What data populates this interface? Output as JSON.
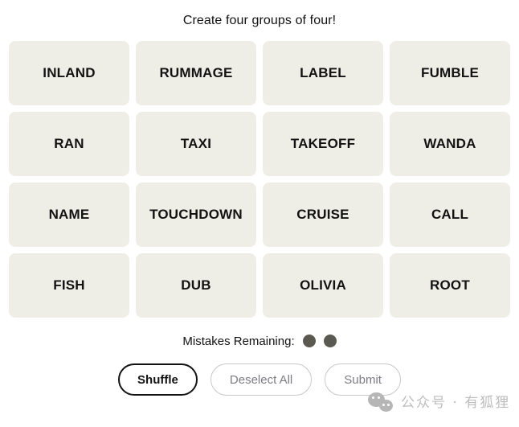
{
  "page": {
    "title": "Create four groups of four!"
  },
  "grid": {
    "tiles": [
      {
        "label": "INLAND"
      },
      {
        "label": "RUMMAGE"
      },
      {
        "label": "LABEL"
      },
      {
        "label": "FUMBLE"
      },
      {
        "label": "RAN"
      },
      {
        "label": "TAXI"
      },
      {
        "label": "TAKEOFF"
      },
      {
        "label": "WANDA"
      },
      {
        "label": "NAME"
      },
      {
        "label": "TOUCHDOWN"
      },
      {
        "label": "CRUISE"
      },
      {
        "label": "CALL"
      },
      {
        "label": "FISH"
      },
      {
        "label": "DUB"
      },
      {
        "label": "OLIVIA"
      },
      {
        "label": "ROOT"
      }
    ],
    "tile_color": "#EFEEE6",
    "tile_text_color": "#121213"
  },
  "mistakes": {
    "label": "Mistakes Remaining:",
    "remaining": 2,
    "dots": [
      "dot",
      "dot"
    ],
    "dot_color": "#5A5A50"
  },
  "controls": {
    "shuffle": {
      "label": "Shuffle",
      "state": "enabled"
    },
    "deselect_all": {
      "label": "Deselect All",
      "state": "disabled"
    },
    "submit": {
      "label": "Submit",
      "state": "disabled"
    }
  },
  "watermark": {
    "text": "公众号 · 有狐狸",
    "icon": "wechat-icon",
    "color": "#BDBDBD"
  }
}
